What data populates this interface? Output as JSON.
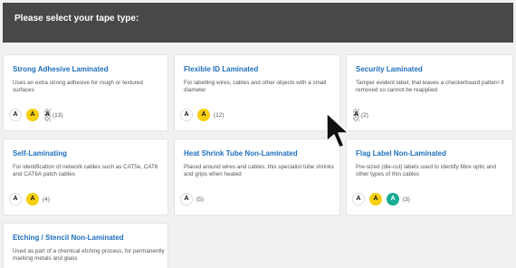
{
  "header": {
    "title": "Please select your tape type:"
  },
  "cards": [
    {
      "title": "Strong Adhesive Laminated",
      "description": "Uses an extra strong adhesive for rough or textured surfaces",
      "variants": [
        "white",
        "yellow",
        "checker"
      ],
      "count": "(13)"
    },
    {
      "title": "Flexible ID Laminated",
      "description": "For labelling wires, cables and other objects with a small diameter",
      "variants": [
        "white",
        "yellow"
      ],
      "count": "(12)"
    },
    {
      "title": "Security Laminated",
      "description": "Tamper evident label, that leaves a checkerboard pattern if removed so cannot be reapplied",
      "variants": [
        "checker"
      ],
      "count": "(2)"
    },
    {
      "title": "Self-Laminating",
      "description": "For identification of network cables such as CAT5e, CAT6 and CAT6A patch cables",
      "variants": [
        "white",
        "yellow"
      ],
      "count": "(4)"
    },
    {
      "title": "Heat Shrink Tube Non-Laminated",
      "description": "Placed around wires and cables, this specialist tube shrinks and grips when heated",
      "variants": [
        "white"
      ],
      "count": "(5)"
    },
    {
      "title": "Flag Label Non-Laminated",
      "description": "Pre-sized (die-cut) labels used to identify fibre optic and other types of thin cables",
      "variants": [
        "white",
        "yellow",
        "teal"
      ],
      "count": "(3)"
    },
    {
      "title": "Etching / Stencil Non-Laminated",
      "description": "Used as part of a chemical etching process, for permanently marking metals and glass",
      "variants": [],
      "count": ""
    }
  ],
  "badge_letter": "A",
  "colors": {
    "header_bg": "#484848",
    "title_blue": "#1f6fbd",
    "badge_yellow": "#f6cf0e",
    "badge_teal": "#17ac93"
  },
  "cursor_icon": "mouse-pointer-icon"
}
